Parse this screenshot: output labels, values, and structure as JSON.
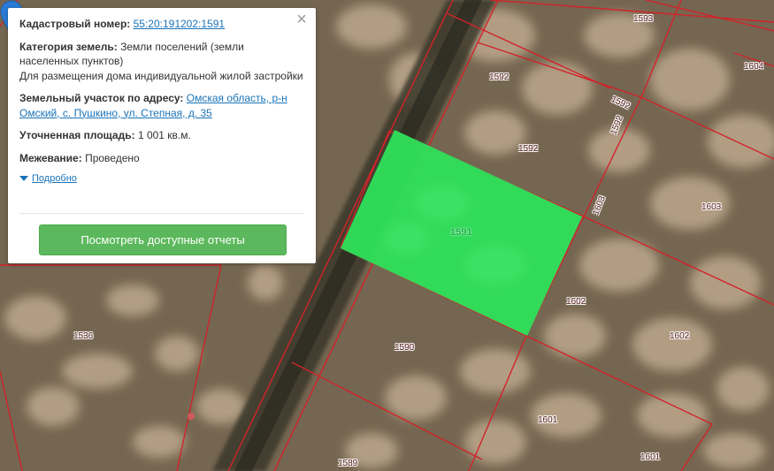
{
  "info": {
    "cadastral_label": "Кадастровый номер:",
    "cadastral_value": "55:20:191202:1591",
    "category_label": "Категория земель:",
    "category_value": "Земли поселений (земли населенных пунктов)",
    "usage_value": "Для размещения дома индивидуальной жилой застройки",
    "address_label": "Земельный участок по адресу:",
    "address_value": "Омская область, р-н Омский, с. Пушкино, ул. Степная, д. 35",
    "area_label": "Уточненная площадь:",
    "area_value": "1 001 кв.м.",
    "survey_label": "Межевание:",
    "survey_value": "Проведено",
    "details_label": "Подробно",
    "reports_button": "Посмотреть доступные отчеты",
    "close_symbol": "×"
  },
  "map": {
    "selected_parcel": "1591",
    "colors": {
      "selected_fill": "#2ee05a",
      "boundary": "#d2232a",
      "road": "#3c3a2c",
      "ground": "#7d6d55"
    },
    "parcel_labels": [
      "1593",
      "1604",
      "1592",
      "1592",
      "1592",
      "1592",
      "1603",
      "1603",
      "1602",
      "1602",
      "1590",
      "1536",
      "1601",
      "1601",
      "1589",
      "159"
    ]
  },
  "icons": {
    "pin": "map-pin-icon",
    "close": "close-icon",
    "details": "triangle-down-icon"
  }
}
